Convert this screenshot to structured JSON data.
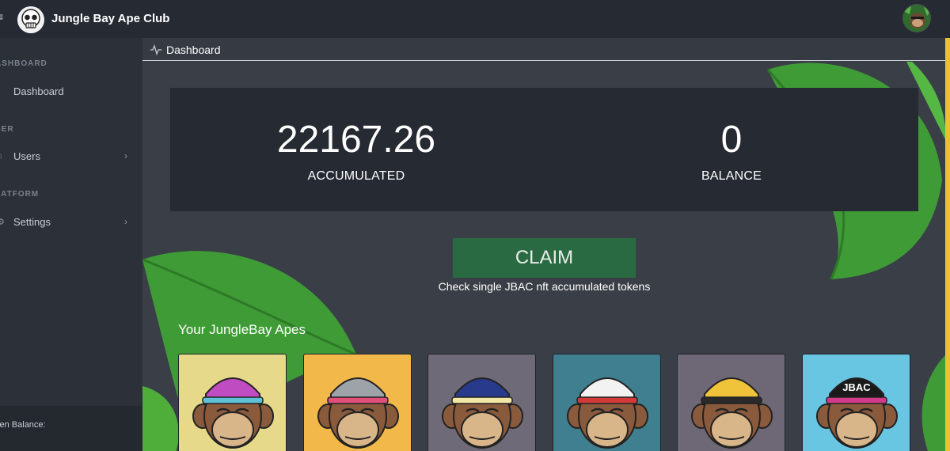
{
  "app": {
    "title": "Jungle Bay Ape Club",
    "menu_icon": "hamburger-icon",
    "logo_icon": "skull-logo-icon",
    "avatar_icon": "ape-avatar-icon"
  },
  "breadcrumb": {
    "icon": "activity-icon",
    "label": "Dashboard"
  },
  "sidebar": {
    "sections": [
      {
        "label": "ASHBOARD"
      },
      {
        "label": "SER"
      },
      {
        "label": "LATFORM"
      }
    ],
    "items": [
      {
        "label": "Dashboard",
        "icon": "dashboard-icon"
      },
      {
        "label": "Users",
        "icon": "users-icon",
        "chevron": "›"
      },
      {
        "label": "Settings",
        "icon": "settings-icon",
        "chevron": "›"
      }
    ],
    "footer_label": "ken Balance:"
  },
  "stats": {
    "accumulated_value": "22167.26",
    "accumulated_label": "ACCUMULATED",
    "balance_value": "0",
    "balance_label": "BALANCE"
  },
  "claim": {
    "button_label": "CLAIM",
    "hint": "Check single JBAC nft accumulated tokens"
  },
  "apes": {
    "title": "Your JungleBay Apes",
    "cards": [
      {
        "bg": "#e6d98a",
        "hat": "#c04cc2",
        "accent": "#5fc1d6"
      },
      {
        "bg": "#f2b94a",
        "hat": "#9ea3aa",
        "accent": "#e14f7a"
      },
      {
        "bg": "#6f6a77",
        "hat": "#283a8c",
        "accent": "#f3e7a5"
      },
      {
        "bg": "#3f7f8f",
        "hat": "#f2f2f2",
        "accent": "#d23a3a"
      },
      {
        "bg": "#6e6775",
        "hat": "#f0c43a",
        "accent": "#2a2a2a"
      },
      {
        "bg": "#69c6e3",
        "hat": "#1a1a1a",
        "accent": "#d43a8a",
        "hat_text": "JBAC"
      }
    ]
  },
  "colors": {
    "topbar": "#252a33",
    "sidebar": "#2b3039",
    "content": "#3a3f47",
    "panel": "#252a33",
    "claim": "#2a6a43",
    "leaf": "#4fae3a"
  }
}
